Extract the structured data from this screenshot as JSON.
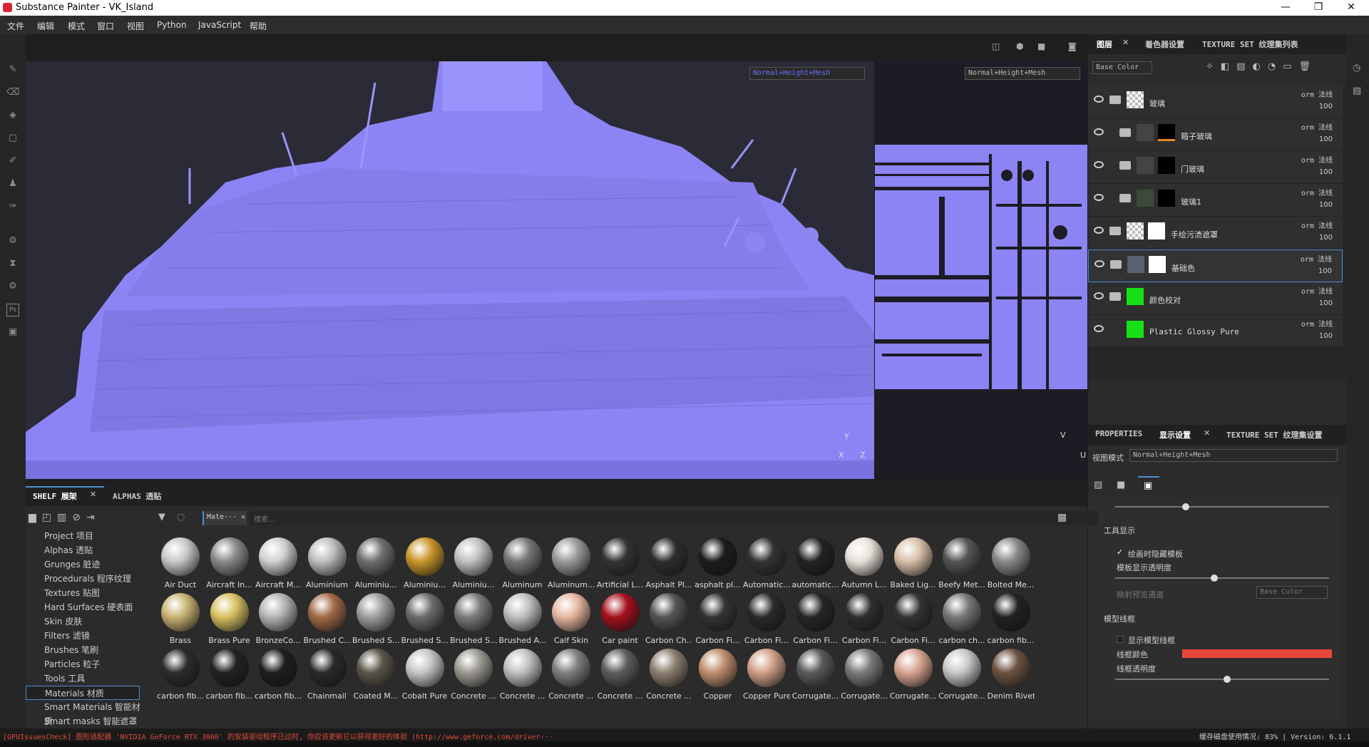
{
  "window": {
    "title": "Substance Painter - VK_Island",
    "controls": [
      "—",
      "❐",
      "✕"
    ]
  },
  "menu": [
    "文件",
    "编辑",
    "模式",
    "窗口",
    "视图",
    "Python",
    "JavaScript",
    "帮助"
  ],
  "viewport": {
    "mode_3d": "Normal+Height+Mesh",
    "mode_2d": "Normal+Height+Mesh",
    "axes_3d": {
      "y": "Y",
      "x": "X",
      "z": "Z"
    },
    "axes_2d": {
      "v": "V",
      "u": "U"
    },
    "normal_color": "#8f87f5"
  },
  "layers_panel": {
    "tabs": [
      "图层",
      "着色器设置",
      "TEXTURE SET 纹理集列表"
    ],
    "channel": "Base Color",
    "layers": [
      {
        "name": "玻璃",
        "blend": "orm 法线",
        "opacity": "100"
      },
      {
        "name": "箱子玻璃",
        "blend": "orm 法线",
        "opacity": "100"
      },
      {
        "name": "门玻璃",
        "blend": "orm 法线",
        "opacity": "100"
      },
      {
        "name": "玻璃1",
        "blend": "orm 法线",
        "opacity": "100"
      },
      {
        "name": "手绘污渍遮罩",
        "blend": "orm 法线",
        "opacity": "100"
      },
      {
        "name": "基础色",
        "blend": "orm 法线",
        "opacity": "100"
      },
      {
        "name": "颜色校对",
        "blend": "orm 法线",
        "opacity": "100"
      },
      {
        "name": "Plastic Glossy Pure",
        "blend": "orm 法线",
        "opacity": "100"
      }
    ]
  },
  "display_panel": {
    "tabs": [
      "PROPERTIES",
      "显示设置",
      "TEXTURE SET 纹理集设置"
    ],
    "view_mode_label": "视图模式",
    "view_mode": "Normal+Height+Mesh",
    "tool_display_title": "工具显示",
    "hide_on_paint": "绘画时隐藏模板",
    "stencil_opacity": "模板显示透明度",
    "projection_channel": "映射预览通道",
    "projection_value": "Base Color",
    "wireframe_title": "模型线框",
    "show_wireframe": "显示模型线框",
    "wire_color_label": "线框颜色",
    "wire_color": "#e8453c",
    "wire_opacity": "线框透明度"
  },
  "shelf": {
    "tabs": [
      "SHELF 展架",
      "ALPHAS 透贴"
    ],
    "filter_chip": "Mate···",
    "search_placeholder": "搜索...",
    "categories": [
      "Project 项目",
      "Alphas 透贴",
      "Grunges 脏迹",
      "Procedurals 程序纹理",
      "Textures 贴图",
      "Hard Surfaces 硬表面",
      "Skin 皮肤",
      "Filters 滤镜",
      "Brushes 笔刷",
      "Particles 粒子",
      "Tools 工具",
      "Materials 材质",
      "Smart Materials 智能材质",
      "Smart masks 智能遮罩"
    ],
    "selected_category": "Materials 材质",
    "materials": [
      {
        "name": "Air Duct",
        "c": "#c8c8c8"
      },
      {
        "name": "Aircraft In...",
        "c": "#8a8a8a"
      },
      {
        "name": "Aircraft M...",
        "c": "#d0d0d0"
      },
      {
        "name": "Aluminium",
        "c": "#bdbdbd"
      },
      {
        "name": "Aluminiu...",
        "c": "#6f6f6f"
      },
      {
        "name": "Aluminiu...",
        "c": "#c8962a"
      },
      {
        "name": "Aluminiu...",
        "c": "#c0c0c0"
      },
      {
        "name": "Aluminum",
        "c": "#777"
      },
      {
        "name": "Aluminum...",
        "c": "#9a9a9a"
      },
      {
        "name": "Artificial L...",
        "c": "#333"
      },
      {
        "name": "Asphalt Pl...",
        "c": "#2e2e2e"
      },
      {
        "name": "asphalt pl...",
        "c": "#1c1c1c"
      },
      {
        "name": "Automatic...",
        "c": "#333"
      },
      {
        "name": "automatic...",
        "c": "#222"
      },
      {
        "name": "Autumn L...",
        "c": "#e7e0d8"
      },
      {
        "name": "Baked Lig...",
        "c": "#d8c0a8"
      },
      {
        "name": "Beefy Met...",
        "c": "#555"
      },
      {
        "name": "Bolted Me...",
        "c": "#888"
      },
      {
        "name": "Brass",
        "c": "#c9b273"
      },
      {
        "name": "Brass Pure",
        "c": "#d8c060"
      },
      {
        "name": "BronzeCo...",
        "c": "#b5b5b5"
      },
      {
        "name": "Brushed C...",
        "c": "#a26a48"
      },
      {
        "name": "Brushed S...",
        "c": "#9e9e9e"
      },
      {
        "name": "Brushed S...",
        "c": "#6c6c6c"
      },
      {
        "name": "Brushed S...",
        "c": "#7a7a7a"
      },
      {
        "name": "Brushed A...",
        "c": "#bfbfbf"
      },
      {
        "name": "Calf Skin",
        "c": "#e6b7a0"
      },
      {
        "name": "Car paint",
        "c": "#a5101c"
      },
      {
        "name": "Carbon Ch...",
        "c": "#555"
      },
      {
        "name": "Carbon Fi...",
        "c": "#333"
      },
      {
        "name": "Carbon Fi...",
        "c": "#2a2a2a"
      },
      {
        "name": "Carbon Fi...",
        "c": "#262626"
      },
      {
        "name": "Carbon Fi...",
        "c": "#2e2e2e"
      },
      {
        "name": "Carbon Fi...",
        "c": "#333"
      },
      {
        "name": "carbon ch...",
        "c": "#777"
      },
      {
        "name": "carbon fib...",
        "c": "#222"
      },
      {
        "name": "carbon fib...",
        "c": "#2c2c2c"
      },
      {
        "name": "carbon fib...",
        "c": "#222"
      },
      {
        "name": "carbon fib...",
        "c": "#1e1e1e"
      },
      {
        "name": "Chainmail",
        "c": "#2a2a2a"
      },
      {
        "name": "Coated M...",
        "c": "#5a5548"
      },
      {
        "name": "Cobalt Pure",
        "c": "#c5c5c5"
      },
      {
        "name": "Concrete ...",
        "c": "#9a9890"
      },
      {
        "name": "Concrete ...",
        "c": "#c0c0c0"
      },
      {
        "name": "Concrete ...",
        "c": "#7f7f7f"
      },
      {
        "name": "Concrete ...",
        "c": "#5e5e5e"
      },
      {
        "name": "Concrete ...",
        "c": "#8c7f70"
      },
      {
        "name": "Copper",
        "c": "#c08d6e"
      },
      {
        "name": "Copper Pure",
        "c": "#d2a088"
      },
      {
        "name": "Corrugate...",
        "c": "#5a5a5a"
      },
      {
        "name": "Corrugate...",
        "c": "#7a7a7a"
      },
      {
        "name": "Corrugate...",
        "c": "#d9a592"
      },
      {
        "name": "Corrugate...",
        "c": "#c8c8c8"
      },
      {
        "name": "Denim Rivet",
        "c": "#6d5240"
      }
    ]
  },
  "status": {
    "left": "[GPUIssuesCheck] 图形适配器 'NVIDIA GeForce RTX 3060' 的安装驱动程序已过时, 你应该更新它以获得更好的体验 (http://www.geforce.com/driver···",
    "right": "缓存磁盘使用情况: 83% | Version: 6.1.1",
    "error_color": "#e04a3a"
  }
}
